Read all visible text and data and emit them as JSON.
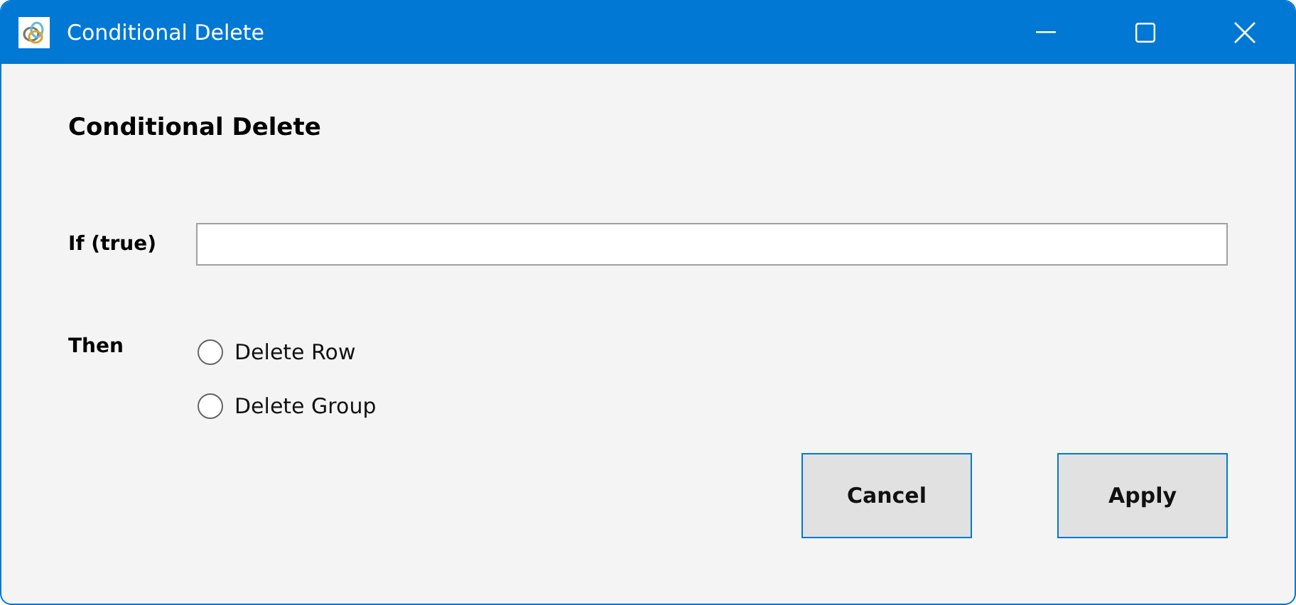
{
  "window": {
    "title": "Conditional Delete"
  },
  "heading": "Conditional Delete",
  "condition": {
    "label": "If (true)"
  },
  "action": {
    "label": "Then",
    "options": [
      {
        "label": "Delete Row",
        "selected": false
      },
      {
        "label": "Delete Group",
        "selected": false
      }
    ]
  },
  "buttons": [
    "Cancel",
    "Apply"
  ]
}
